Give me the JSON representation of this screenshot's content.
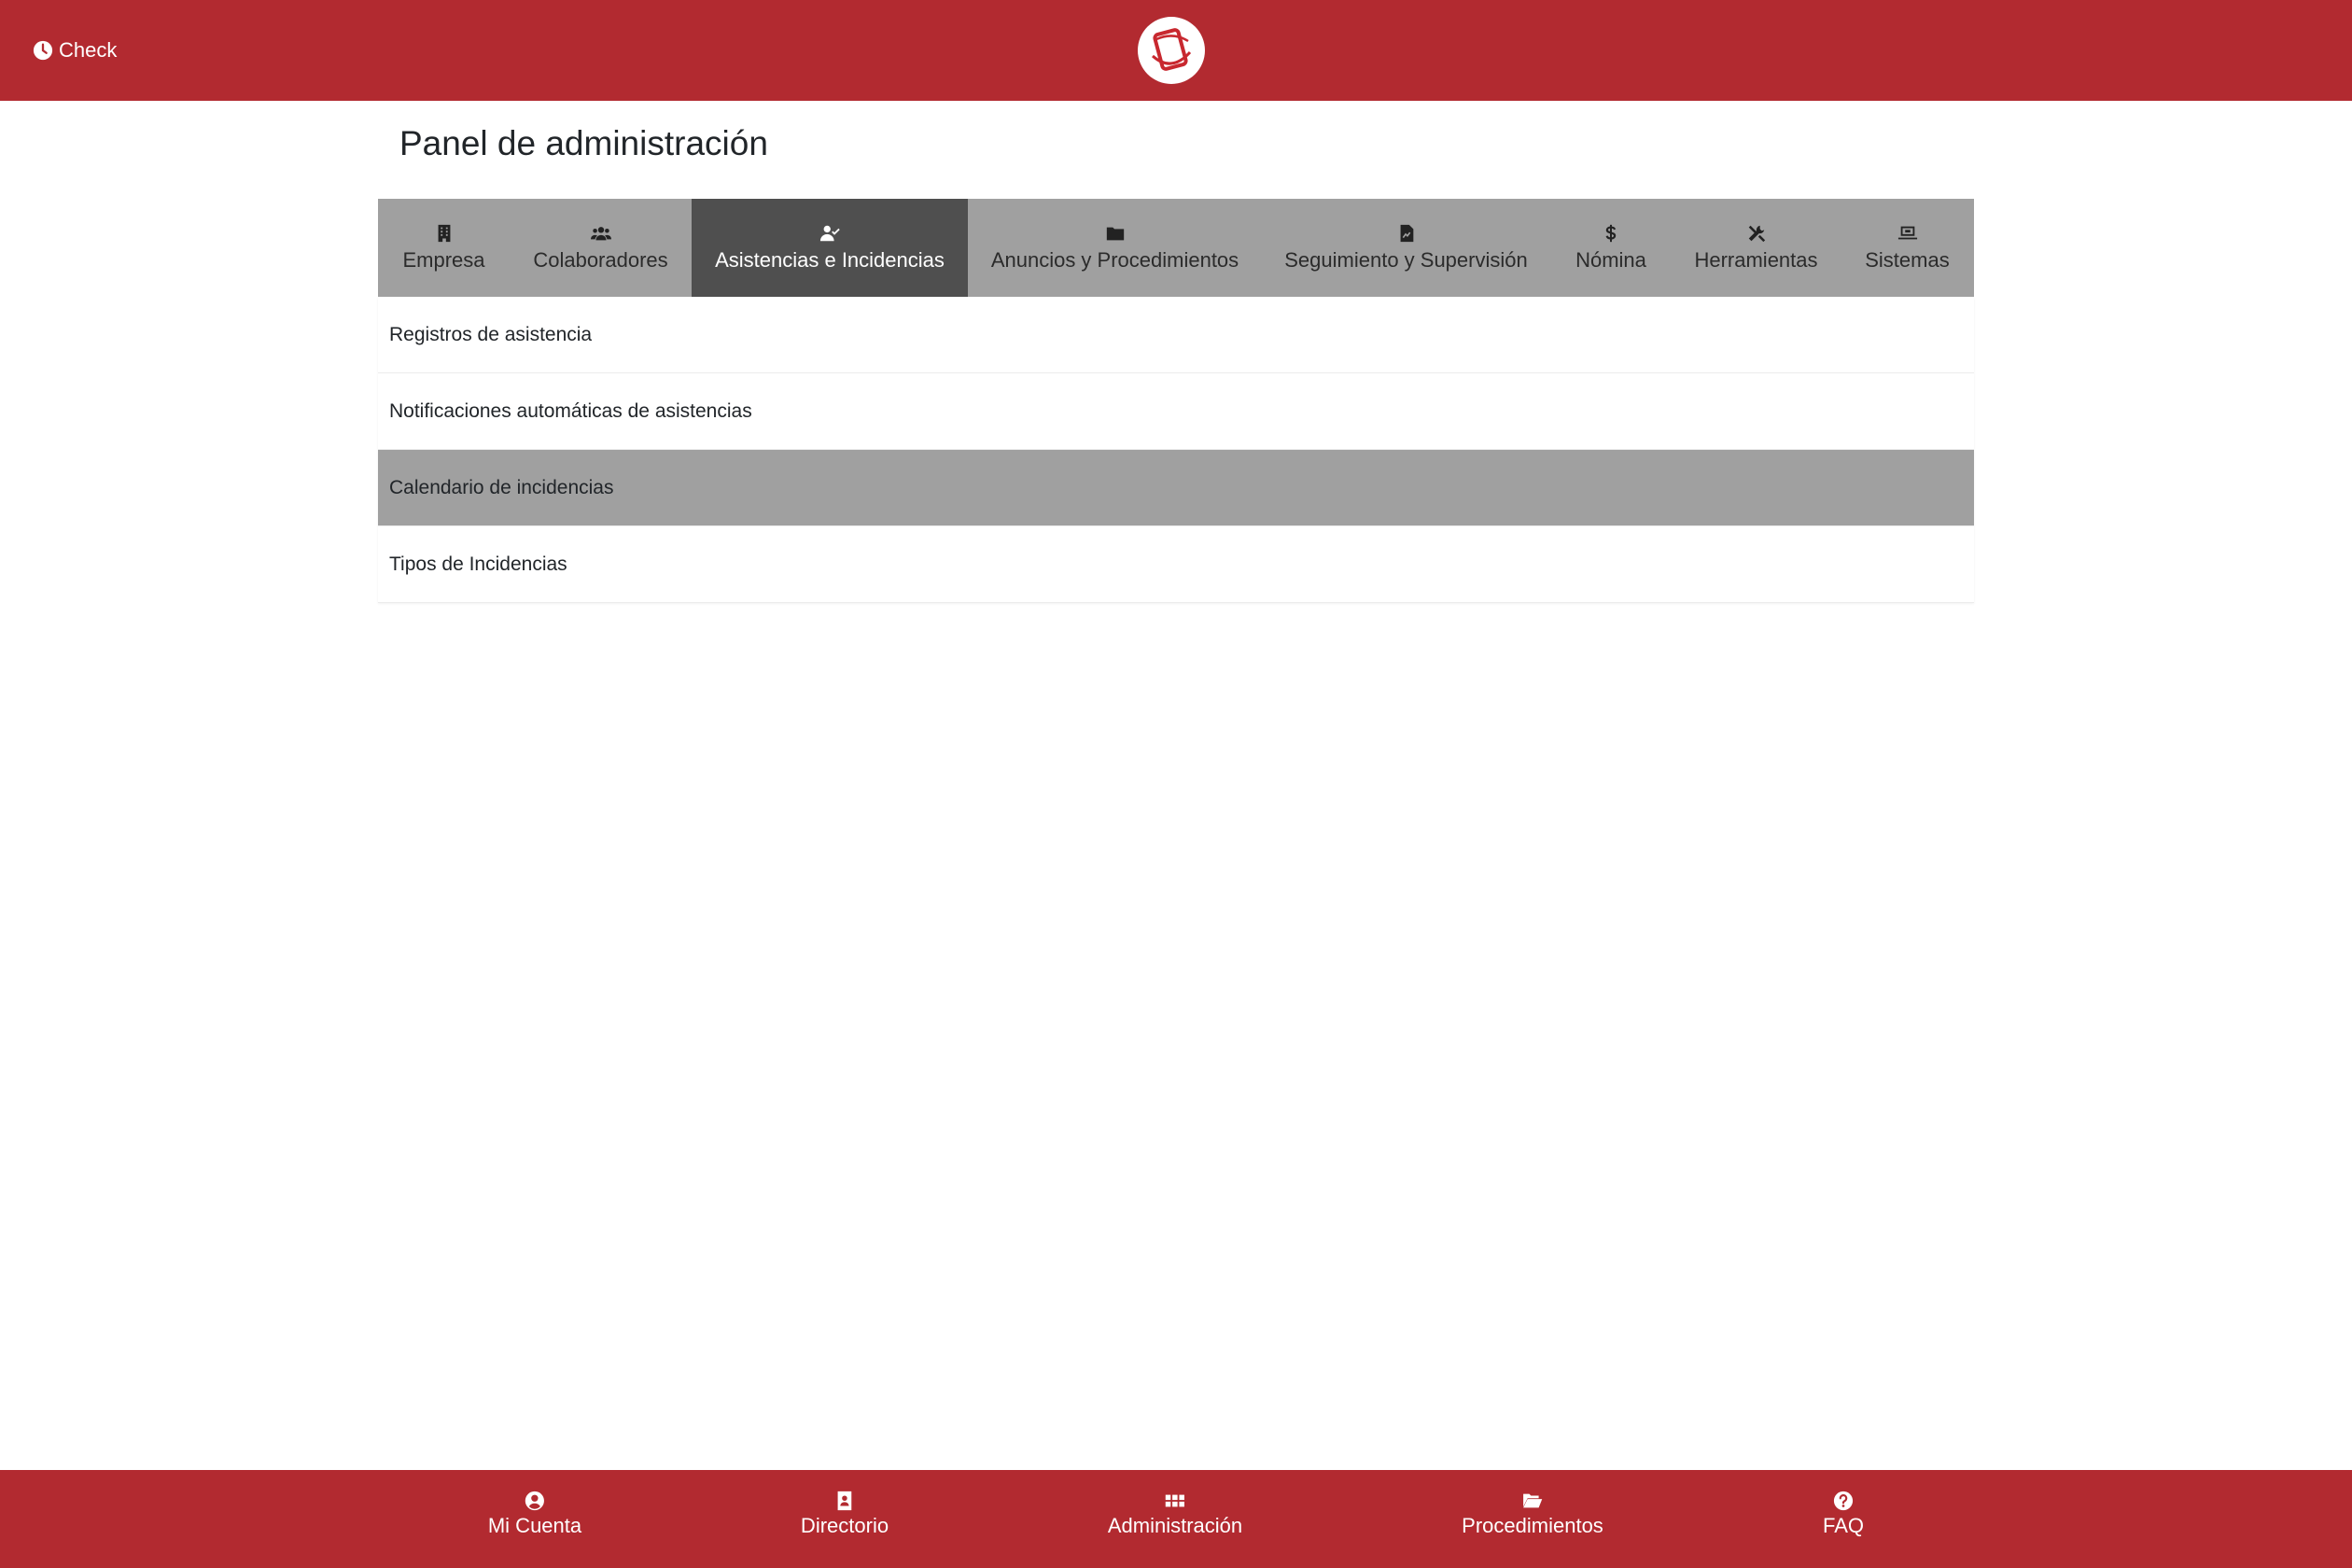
{
  "header": {
    "check_label": "Check",
    "check_icon": "clock-icon",
    "brand_color": "#b22a30"
  },
  "page": {
    "title": "Panel de administración"
  },
  "tabs": [
    {
      "label": "Empresa",
      "icon": "building-icon",
      "active": false
    },
    {
      "label": "Colaboradores",
      "icon": "users-icon",
      "active": false
    },
    {
      "label": "Asistencias e Incidencias",
      "icon": "user-check-icon",
      "active": true
    },
    {
      "label": "Anuncios y Procedimientos",
      "icon": "folder-icon",
      "active": false
    },
    {
      "label": "Seguimiento y Supervisión",
      "icon": "file-chart-icon",
      "active": false
    },
    {
      "label": "Nómina",
      "icon": "dollar-icon",
      "active": false
    },
    {
      "label": "Herramientas",
      "icon": "tools-icon",
      "active": false
    },
    {
      "label": "Sistemas",
      "icon": "laptop-icon",
      "active": false
    }
  ],
  "submenu": [
    {
      "label": "Registros de asistencia",
      "active": false
    },
    {
      "label": "Notificaciones automáticas de asistencias",
      "active": false
    },
    {
      "label": "Calendario de incidencias",
      "active": true
    },
    {
      "label": "Tipos de Incidencias",
      "active": false
    }
  ],
  "bottom_nav": [
    {
      "label": "Mi Cuenta",
      "icon": "user-circle-icon"
    },
    {
      "label": "Directorio",
      "icon": "address-book-icon"
    },
    {
      "label": "Administración",
      "icon": "grid-icon"
    },
    {
      "label": "Procedimientos",
      "icon": "folder-open-icon"
    },
    {
      "label": "FAQ",
      "icon": "question-circle-icon"
    }
  ],
  "colors": {
    "tab_bar": "#a0a0a0",
    "tab_active": "#4f4f4f",
    "row_active": "#a0a0a0"
  }
}
